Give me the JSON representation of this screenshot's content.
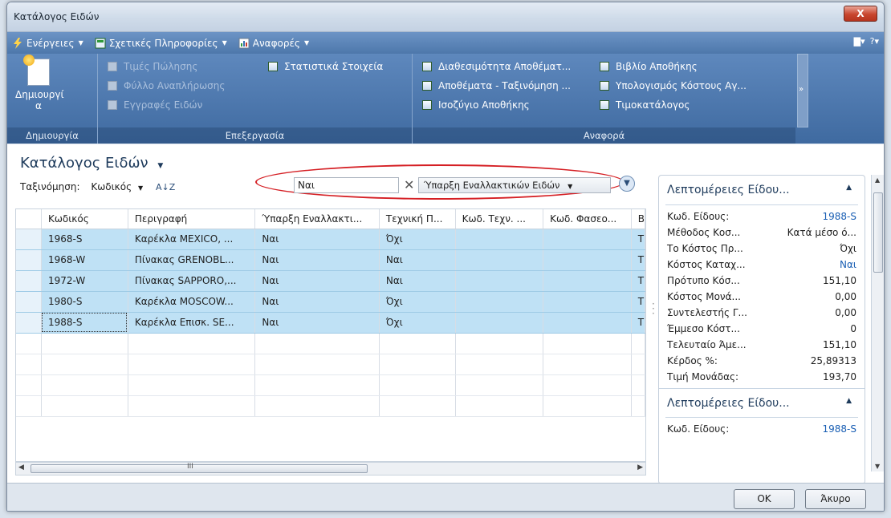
{
  "window": {
    "title": "Κατάλογος Ειδών",
    "close_label": "X"
  },
  "menubar": {
    "items": [
      {
        "label": "Ενέργειες",
        "icon": "lightning-icon"
      },
      {
        "label": "Σχετικές Πληροφορίες",
        "icon": "info-panel-icon"
      },
      {
        "label": "Αναφορές",
        "icon": "report-icon"
      }
    ],
    "help": "?"
  },
  "ribbon": {
    "groups": [
      {
        "label": "Δημιουργία"
      },
      {
        "label": "Επεξεργασία"
      },
      {
        "label": "Αναφορά"
      }
    ],
    "create_label": "Δημιουργί\nα",
    "edit_buttons": [
      "Τιμές Πώλησης",
      "Φύλλο Αναπλήρωσης",
      "Εγγραφές Ειδών"
    ],
    "stats_button": "Στατιστικά Στοιχεία",
    "report_buttons": [
      "Διαθεσιμότητα Αποθέματ...",
      "Αποθέματα - Ταξινόμηση ...",
      "Ισοζύγιο Αποθήκης",
      "Βιβλίο Αποθήκης",
      "Υπολογισμός Κόστους Αγ...",
      "Τιμοκατάλογος"
    ],
    "more": "»"
  },
  "list": {
    "title": "Κατάλογος Ειδών",
    "sort_label": "Ταξινόμηση:",
    "sort_value": "Κωδικός",
    "filter_value": "Ναι",
    "filter_field": "Ύπαρξη Εναλλακτικών Ειδών",
    "columns": [
      "Κωδικός",
      "Περιγραφή",
      "Ύπαρξη Εναλλακτι...",
      "Τεχνική Π...",
      "Κωδ. Τεχν. ...",
      "Κωδ. Φασεο...",
      "Β"
    ],
    "rows": [
      [
        "1968-S",
        "Καρέκλα MEXICO, ...",
        "Ναι",
        "Όχι",
        "",
        "",
        "T"
      ],
      [
        "1968-W",
        "Πίνακας GRENOBL...",
        "Ναι",
        "Ναι",
        "",
        "",
        "T"
      ],
      [
        "1972-W",
        "Πίνακας SAPPORO,...",
        "Ναι",
        "Ναι",
        "",
        "",
        "T"
      ],
      [
        "1980-S",
        "Καρέκλα MOSCOW...",
        "Ναι",
        "Όχι",
        "",
        "",
        "T"
      ],
      [
        "1988-S",
        "Καρέκλα Επισκ. SE...",
        "Ναι",
        "Όχι",
        "",
        "",
        "T"
      ]
    ],
    "scroll_grip": "III"
  },
  "factbox": {
    "title": "Λεπτομέρειες Είδου...",
    "title2": "Λεπτομέρειες Είδου...",
    "fields": [
      {
        "label": "Κωδ. Είδους:",
        "value": "1988-S",
        "link": true
      },
      {
        "label": "Μέθοδος Κοσ...",
        "value": "Κατά μέσο ό...",
        "link": false
      },
      {
        "label": "Το Κόστος Πρ...",
        "value": "Όχι",
        "link": false
      },
      {
        "label": "Κόστος Καταχ...",
        "value": "Ναι",
        "link": true
      },
      {
        "label": "Πρότυπο Κόσ...",
        "value": "151,10",
        "link": false
      },
      {
        "label": "Κόστος Μονά...",
        "value": "0,00",
        "link": false
      },
      {
        "label": "Συντελεστής Γ...",
        "value": "0,00",
        "link": false
      },
      {
        "label": "Έμμεσο Κόστ...",
        "value": "0",
        "link": false
      },
      {
        "label": "Τελευταίο Άμε...",
        "value": "151,10",
        "link": false
      },
      {
        "label": "Κέρδος %:",
        "value": "25,89313",
        "link": false
      },
      {
        "label": "Τιμή Μονάδας:",
        "value": "193,70",
        "link": false
      }
    ],
    "fields2": [
      {
        "label": "Κωδ. Είδους:",
        "value": "1988-S",
        "link": true
      }
    ]
  },
  "buttons": {
    "ok": "OK",
    "cancel": "Άκυρο"
  },
  "colors": {
    "accent": "#4d77ab",
    "selection": "#bfe1f5",
    "highlight_oval": "#d51f24"
  }
}
